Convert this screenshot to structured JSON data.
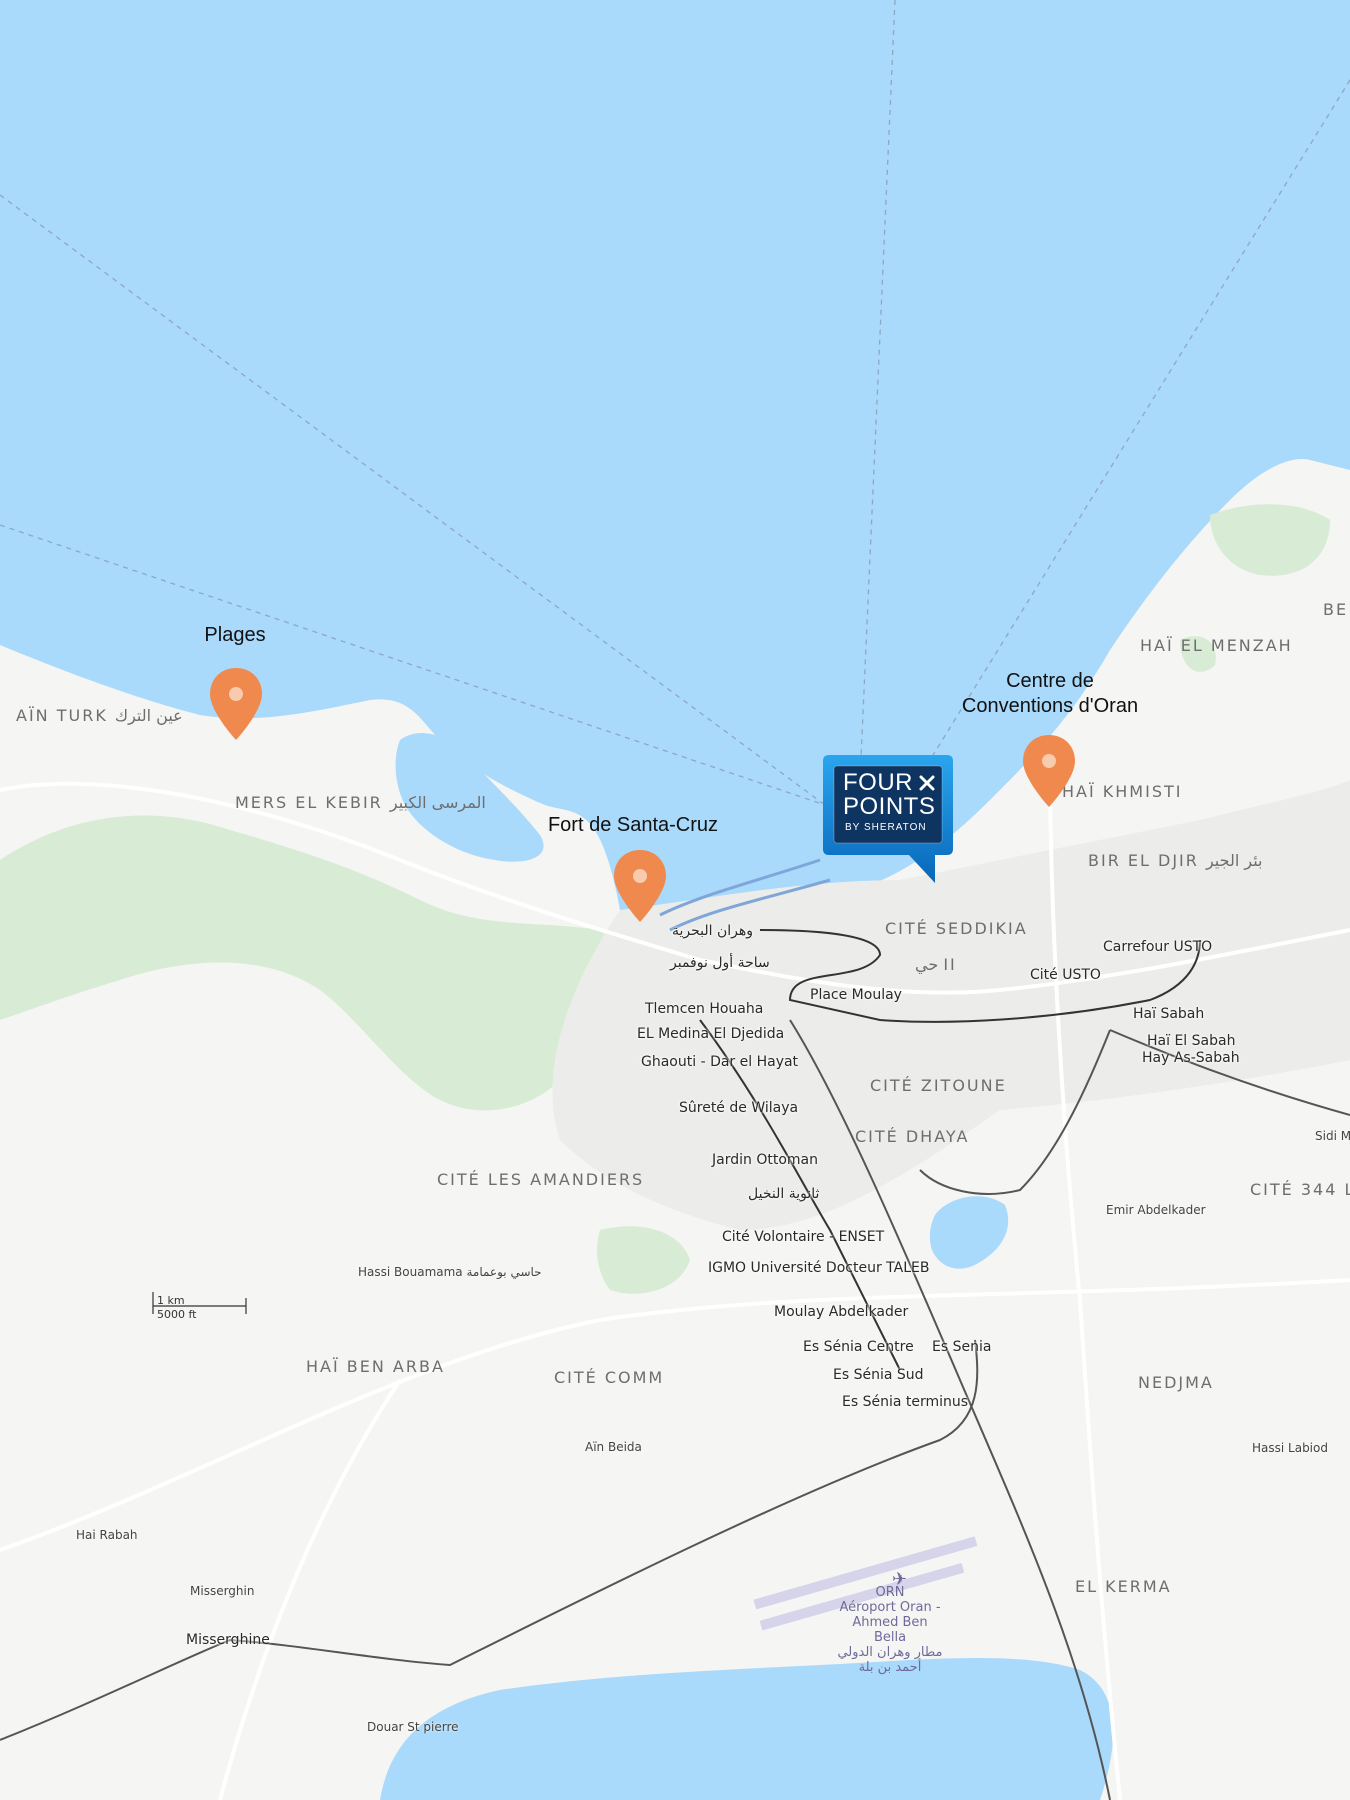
{
  "colors": {
    "water": "#a9d9fb",
    "land": "#f5f5f3",
    "park": "#d8ecd5",
    "road": "#ffffff",
    "pin": "#f0894d",
    "hotel_brand": "#0a7fd0"
  },
  "hotel": {
    "line1": "FOUR",
    "line2": "POINTS",
    "line3": "BY SHERATON"
  },
  "pois": [
    {
      "title_lines": [
        "Plages"
      ]
    },
    {
      "title_lines": [
        "Fort de Santa-Cruz"
      ]
    },
    {
      "title_lines": [
        "Centre de",
        "Conventions d'Oran"
      ]
    }
  ],
  "districts": {
    "ain_turk": "AÏN TURK عين الترك",
    "mers_el_kebir": "MERS EL KEBIR المرسى الكبير",
    "hai_el_menzah": "HAÏ EL MENZAH",
    "hai_khmisti": "HAÏ KHMISTI",
    "bir_el_djir": "BIR EL DJIR بئر الجير",
    "cite_seddikia": "CITÉ SEDDIKIA",
    "cite_zitoune": "CITÉ ZITOUNE",
    "cite_dhaya": "CITÉ DHAYA",
    "cite_les_amandiers": "CITÉ LES AMANDIERS",
    "hai_ben_arba": "HAÏ BEN ARBA",
    "cite_comm": "CITÉ COMM",
    "nedjma": "NEDJMA",
    "el_kerma": "EL KERMA",
    "cite_344": "CITÉ 344 L",
    "be": "BE",
    "hai_ii": "حي II"
  },
  "stops": [
    "وهران البحرية",
    "ساحة أول نوفمبر",
    "Place Moulay",
    "Tlemcen Houaha",
    "EL Medina El Djedida",
    "Ghaouti - Dar el Hayat",
    "Sûreté de Wilaya",
    "Jardin Ottoman",
    "ثانوية النخيل",
    "Cité Volontaire - ENSET",
    "IGMO Université Docteur TALEB",
    "Moulay Abdelkader",
    "Es Sénia Centre",
    "Es Senia",
    "Es Sénia Sud",
    "Es Sénia terminus",
    "Carrefour USTO",
    "Cité USTO",
    "Haï Sabah",
    "Haï El Sabah",
    "Hay As-Sabah"
  ],
  "places": {
    "hassi_bouamama": "Hassi Bouamama حاسي بوعمامة",
    "emir_abdelkader": "Emir Abdelkader",
    "sidi_m": "Sidi M",
    "hassi_labiod": "Hassi Labiod",
    "ain_beida": "Aïn Beida",
    "hai_rabah": "Hai Rabah",
    "misserghin": "Misserghin",
    "misserghine": "Misserghine",
    "douar_st_pierre": "Douar St pierre"
  },
  "airport": {
    "code": "ORN",
    "name_fr": "Aéroport Oran - Ahmed Ben Bella",
    "name_ar": "مطار وهران الدولي أحمد بن بلة"
  },
  "scale": {
    "metric": "1 km",
    "imperial": "5000 ft"
  }
}
